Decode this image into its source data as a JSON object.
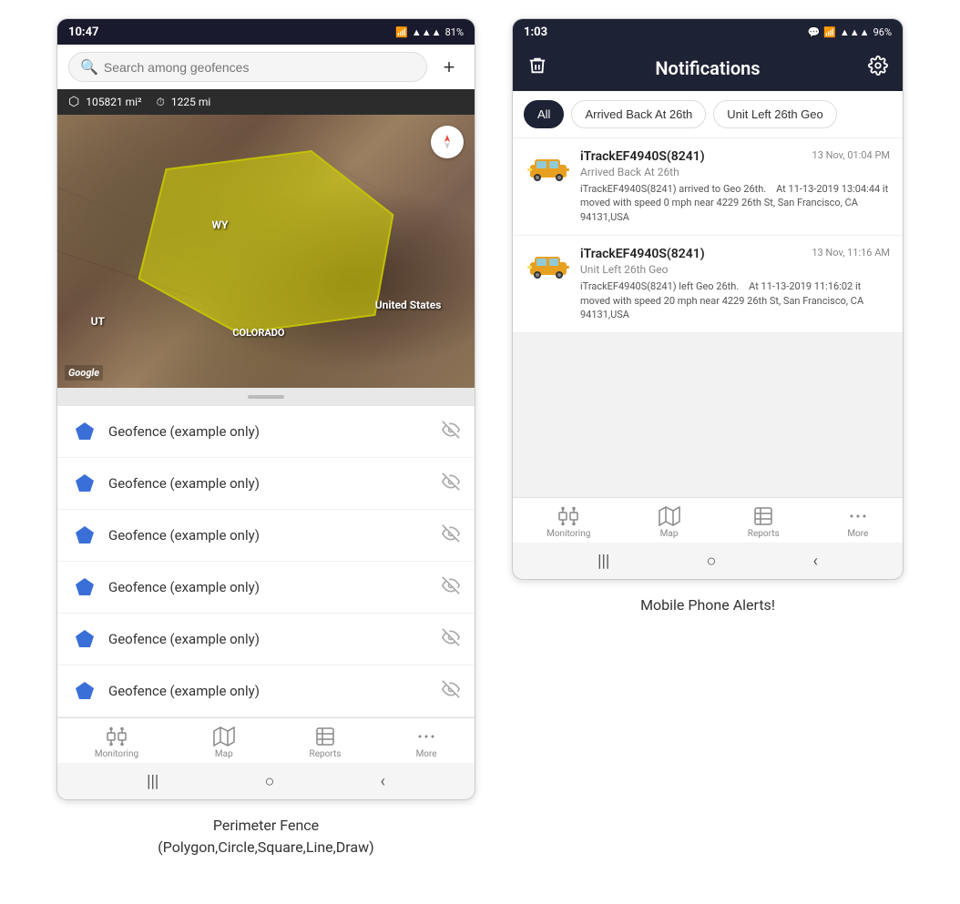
{
  "leftPhone": {
    "statusBar": {
      "time": "10:47",
      "wifi": "WiFi",
      "signal": "4G",
      "battery": "81%"
    },
    "search": {
      "placeholder": "Search among geofences"
    },
    "mapStats": {
      "area": "105821 mi²",
      "distance": "1225 mi"
    },
    "mapLabels": {
      "wy": "WY",
      "ut": "UT",
      "colorado": "COLORADO",
      "unitedStates": "United States",
      "google": "Google"
    },
    "geofenceItems": [
      {
        "name": "Geofence (example only)"
      },
      {
        "name": "Geofence (example only)"
      },
      {
        "name": "Geofence (example only)"
      },
      {
        "name": "Geofence (example only)"
      },
      {
        "name": "Geofence (example only)"
      },
      {
        "name": "Geofence (example only)"
      }
    ],
    "bottomNav": [
      {
        "label": "Monitoring",
        "icon": "🚌"
      },
      {
        "label": "Map",
        "icon": "🗺"
      },
      {
        "label": "Reports",
        "icon": "📊"
      },
      {
        "label": "More",
        "icon": "···"
      }
    ],
    "caption": "Perimeter Fence\n(Polygon,Circle,Square,Line,Draw)"
  },
  "rightPhone": {
    "statusBar": {
      "time": "1:03",
      "battery": "96%"
    },
    "header": {
      "title": "Notifications",
      "deleteIcon": "🗑",
      "settingsIcon": "⚙"
    },
    "filterTabs": [
      {
        "label": "All",
        "active": true
      },
      {
        "label": "Arrived Back At 26th",
        "active": false
      },
      {
        "label": "Unit Left 26th Geo",
        "active": false
      }
    ],
    "notifications": [
      {
        "vehicleName": "iTrackEF4940S(8241)",
        "time": "13 Nov, 01:04 PM",
        "eventType": "Arrived Back At 26th",
        "detail": "iTrackEF4940S(8241) arrived to Geo 26th.    At 11-13-2019 13:04:44 it moved with speed 0 mph near 4229 26th St, San Francisco, CA 94131,USA"
      },
      {
        "vehicleName": "iTrackEF4940S(8241)",
        "time": "13 Nov, 11:16 AM",
        "eventType": "Unit Left 26th Geo",
        "detail": "iTrackEF4940S(8241) left Geo 26th.    At 11-13-2019 11:16:02 it moved with speed 20 mph near 4229 26th St, San Francisco, CA 94131,USA"
      }
    ],
    "bottomNav": [
      {
        "label": "Monitoring",
        "icon": "🚌"
      },
      {
        "label": "Map",
        "icon": "🗺"
      },
      {
        "label": "Reports",
        "icon": "📊"
      },
      {
        "label": "More",
        "icon": "···"
      }
    ],
    "caption": "Mobile Phone Alerts!"
  }
}
